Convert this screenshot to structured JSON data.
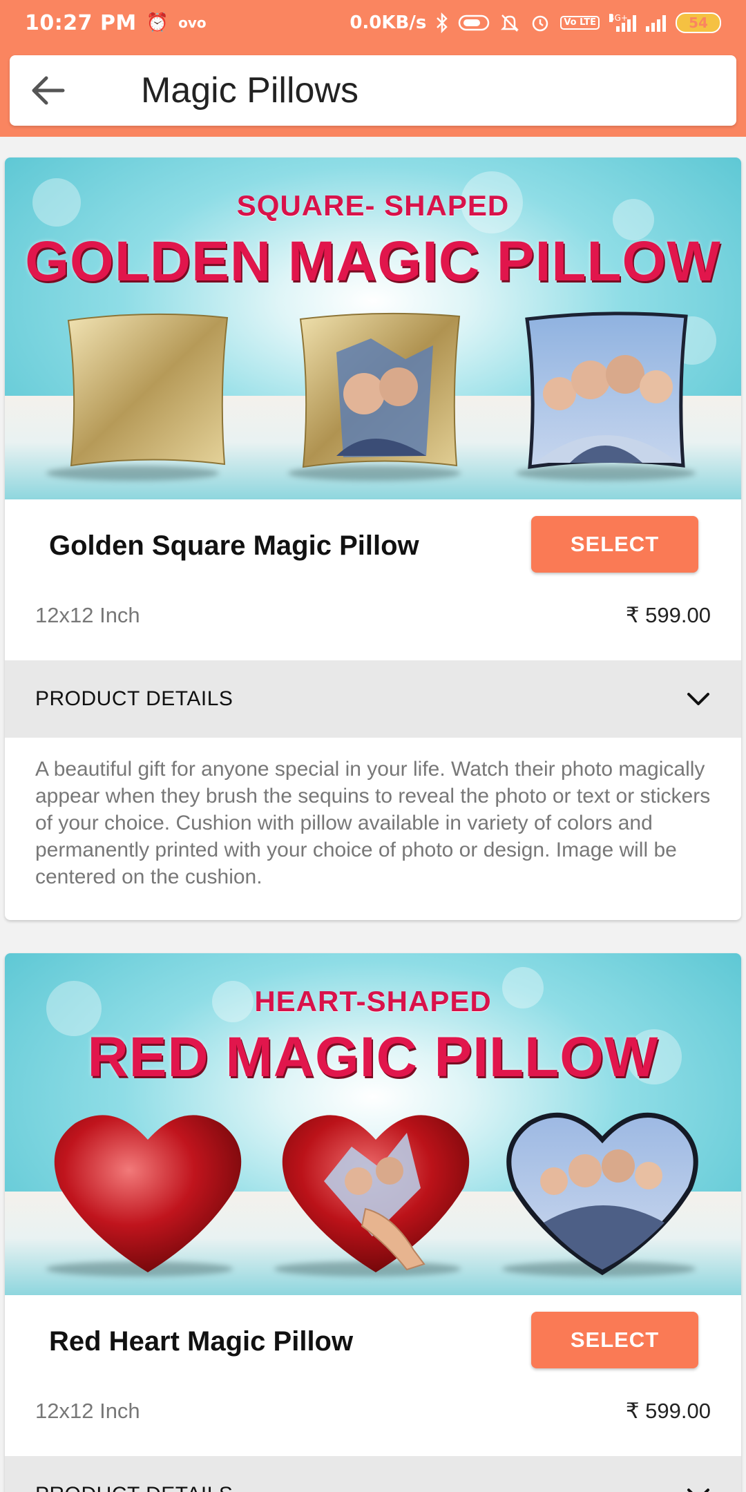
{
  "status_bar": {
    "time": "10:27 PM",
    "ovo": "ovo",
    "net_speed": "0.0KB/s",
    "volte": "Vo LTE",
    "network_type": "4G+",
    "battery": "54",
    "icons": [
      "alarm-icon",
      "bluetooth-icon",
      "toggle-icon",
      "mute-icon",
      "alarm-clock-icon",
      "signal-icon",
      "battery-icon"
    ],
    "background_color": "#fa8560"
  },
  "header": {
    "title": "Magic Pillows",
    "back_icon": "arrow-left-icon"
  },
  "products": [
    {
      "banner_subtitle": "SQUARE- SHAPED",
      "banner_title": "GOLDEN MAGIC PILLOW",
      "name": "Golden Square Magic Pillow",
      "select_label": "SELECT",
      "size": "12x12 Inch",
      "price": "₹ 599.00",
      "details_label": "PRODUCT DETAILS",
      "description": "A beautiful gift for anyone special in your life. Watch their photo magically appear when they brush the sequins to reveal the photo or text or stickers of your choice. Cushion with pillow available in variety of colors and permanently printed with your choice of photo or design. Image will be centered on the cushion."
    },
    {
      "banner_subtitle": "HEART-SHAPED",
      "banner_title": "RED MAGIC PILLOW",
      "name": "Red Heart Magic Pillow",
      "select_label": "SELECT",
      "size": "12x12 Inch",
      "price": "₹ 599.00",
      "details_label": "PRODUCT DETAILS"
    }
  ],
  "colors": {
    "accent": "#fa7a55",
    "banner_text": "#e1164c",
    "details_bg": "#e8e8e8"
  }
}
